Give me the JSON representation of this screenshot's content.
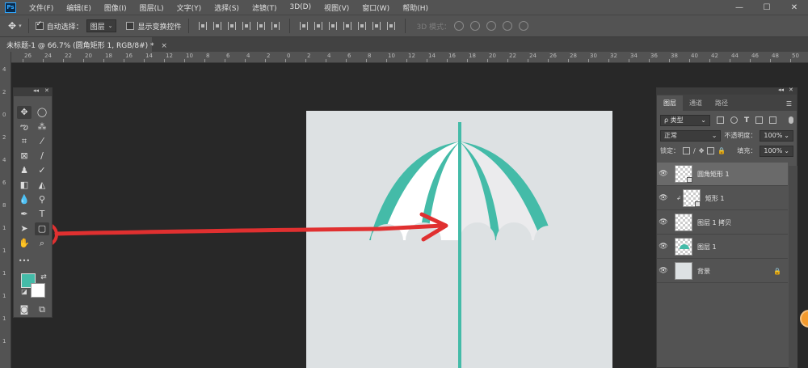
{
  "app": {
    "logo": "Ps",
    "menu": [
      "文件(F)",
      "编辑(E)",
      "图像(I)",
      "图层(L)",
      "文字(Y)",
      "选择(S)",
      "滤镜(T)",
      "3D(D)",
      "视图(V)",
      "窗口(W)",
      "帮助(H)"
    ],
    "window_controls": [
      "—",
      "☐",
      "✕"
    ]
  },
  "options": {
    "move_tool_icon": "move-arrows",
    "auto_select_label": "自动选择：",
    "auto_select_checked": true,
    "auto_select_value": "图层",
    "show_transform_label": "显示变换控件",
    "show_transform_checked": false,
    "mode_3d_label": "3D 模式："
  },
  "document": {
    "tab_title": "未标题-1 @ 66.7% (圆角矩形 1, RGB/8#) *",
    "close": "×"
  },
  "rulers": {
    "top_labels": [
      "26",
      "24",
      "22",
      "20",
      "18",
      "16",
      "14",
      "12",
      "10",
      "8",
      "6",
      "4",
      "2",
      "0",
      "2",
      "4",
      "6",
      "8",
      "10",
      "12",
      "14",
      "16",
      "18",
      "20",
      "22",
      "24",
      "26",
      "28",
      "30",
      "32",
      "34",
      "36",
      "38",
      "40",
      "42",
      "44",
      "46",
      "48",
      "50"
    ],
    "left_labels": [
      "4",
      "2",
      "0",
      "2",
      "4",
      "6",
      "8",
      "1",
      "1",
      "1",
      "1",
      "1",
      "1"
    ]
  },
  "toolbar": {
    "header_collapse": "◂◂",
    "header_close": "✕",
    "more": "•••",
    "foreground_color": "#44bba8",
    "background_color": "#ffffff",
    "tools": [
      "move",
      "ellipse-marquee",
      "lasso",
      "magic-wand",
      "crop",
      "eyedropper",
      "frame",
      "brush",
      "stamp",
      "history-brush",
      "eraser",
      "paint-bucket",
      "blur",
      "dodge",
      "pen",
      "type",
      "path-select",
      "rounded-rectangle",
      "hand",
      "zoom"
    ]
  },
  "canvas": {
    "background": "#dde1e3",
    "umbrella_color": "#44bba8",
    "annotation_color": "#e03030"
  },
  "layers": {
    "header_collapse": "◂◂",
    "header_close": "✕",
    "tabs": [
      "图层",
      "通道",
      "路径"
    ],
    "active_tab": 0,
    "menu_icon": "☰",
    "filter_label": "ρ 类型",
    "blend_mode": "正常",
    "opacity_label": "不透明度：",
    "opacity_value": "100%",
    "lock_label": "锁定：",
    "fill_label": "填充：",
    "fill_value": "100%",
    "items": [
      {
        "name": "圆角矩形 1",
        "selected": true,
        "clipped": false,
        "locked": false
      },
      {
        "name": "矩形 1",
        "selected": false,
        "clipped": true,
        "locked": false
      },
      {
        "name": "图层 1 拷贝",
        "selected": false,
        "clipped": false,
        "locked": false
      },
      {
        "name": "图层 1",
        "selected": false,
        "clipped": false,
        "locked": false
      },
      {
        "name": "背景",
        "selected": false,
        "clipped": false,
        "locked": true
      }
    ]
  }
}
